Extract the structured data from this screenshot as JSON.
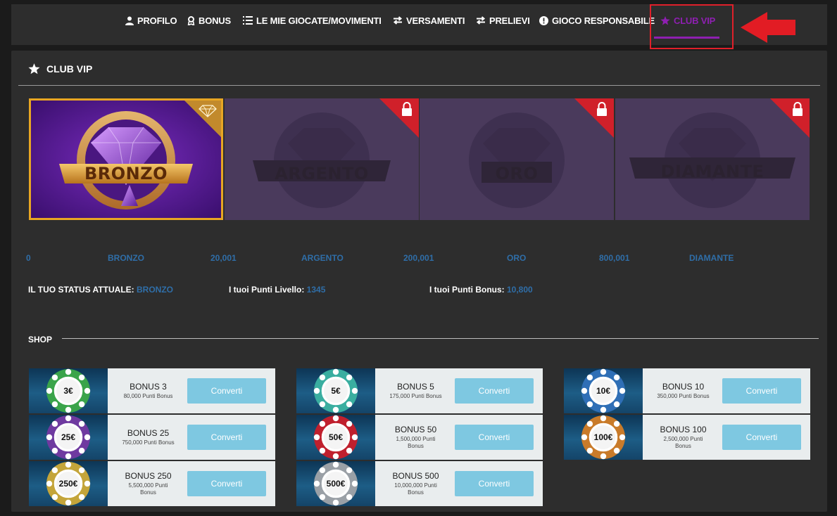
{
  "nav": {
    "items": [
      {
        "label": "PROFILO",
        "icon": "user-icon"
      },
      {
        "label": "BONUS",
        "icon": "award-icon"
      },
      {
        "label": "LE MIE GIOCATE/MOVIMENTI",
        "icon": "list-icon"
      },
      {
        "label": "VERSAMENTI",
        "icon": "exchange-icon"
      },
      {
        "label": "PRELIEVI",
        "icon": "exchange-icon"
      },
      {
        "label": "GIOCO RESPONSABILE",
        "icon": "alert-circle-icon"
      },
      {
        "label": "CLUB VIP",
        "icon": "star-icon",
        "active": true
      }
    ]
  },
  "page": {
    "title": "CLUB VIP"
  },
  "tiers": [
    {
      "label": "BRONZO",
      "locked": false,
      "active": true
    },
    {
      "label": "ARGENTO",
      "locked": true
    },
    {
      "label": "ORO",
      "locked": true
    },
    {
      "label": "DIAMANTE",
      "locked": true
    }
  ],
  "milestones": [
    {
      "text": "0"
    },
    {
      "text": "BRONZO"
    },
    {
      "text": "20,001"
    },
    {
      "text": "ARGENTO"
    },
    {
      "text": "200,001"
    },
    {
      "text": "ORO"
    },
    {
      "text": "800,001"
    },
    {
      "text": "DIAMANTE"
    }
  ],
  "status": {
    "current_label": "IL TUO STATUS ATTUALE:",
    "current_value": "BRONZO",
    "level_points_label": "I tuoi Punti Livello:",
    "level_points_value": "1345",
    "bonus_points_label": "I tuoi Punti Bonus:",
    "bonus_points_value": "10,800"
  },
  "shop": {
    "title": "SHOP",
    "button_label": "Converti",
    "items": [
      {
        "chip": "3€",
        "name": "BONUS 3",
        "points": "80,000 Punti Bonus",
        "color": "#3aa44a"
      },
      {
        "chip": "5€",
        "name": "BONUS 5",
        "points": "175,000 Punti Bonus",
        "color": "#3aaea0"
      },
      {
        "chip": "10€",
        "name": "BONUS 10",
        "points": "350,000 Punti Bonus",
        "color": "#2f6fb6"
      },
      {
        "chip": "25€",
        "name": "BONUS 25",
        "points": "750,000 Punti Bonus",
        "color": "#6f3aa0"
      },
      {
        "chip": "50€",
        "name": "BONUS 50",
        "points": "1,500,000 Punti Bonus",
        "color": "#c0202e"
      },
      {
        "chip": "100€",
        "name": "BONUS 100",
        "points": "2,500,000 Punti Bonus",
        "color": "#c97b2a"
      },
      {
        "chip": "250€",
        "name": "BONUS 250",
        "points": "5,500,000 Punti Bonus",
        "color": "#c4a53a"
      },
      {
        "chip": "500€",
        "name": "BONUS 500",
        "points": "10,000,000 Punti Bonus",
        "color": "#9aa0a6"
      }
    ]
  },
  "colors": {
    "accent": "#8e1fb1",
    "highlight": "#e0202a",
    "link": "#2f6ea8",
    "gold": "#e8a623",
    "button": "#7ec8e1"
  }
}
